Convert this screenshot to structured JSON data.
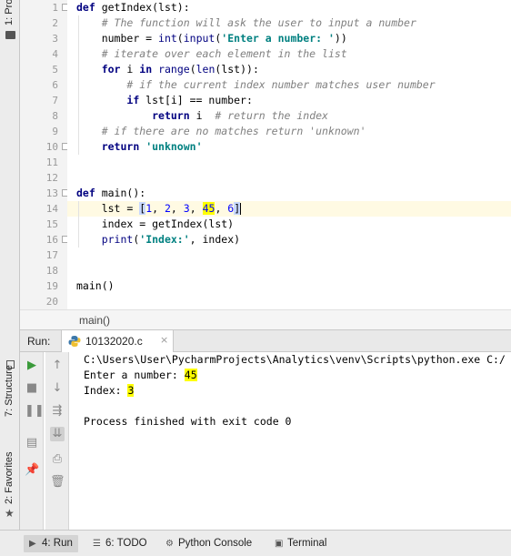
{
  "left_stripe": {
    "project_tab": "1: Pro",
    "structure_tab": "7: Structure",
    "favorites_tab": "2: Favorites"
  },
  "editor": {
    "line_numbers": [
      "1",
      "2",
      "3",
      "4",
      "5",
      "6",
      "7",
      "8",
      "9",
      "10",
      "11",
      "12",
      "13",
      "14",
      "15",
      "16",
      "17",
      "18",
      "19",
      "20"
    ],
    "caret_line": 14,
    "code": {
      "l1": {
        "kw": "def",
        "rest": " getIndex(lst):"
      },
      "l2": {
        "comment": "# The function will ask the user to input a number"
      },
      "l3": {
        "a": "number = ",
        "builtin1": "int",
        "b": "(",
        "builtin2": "input",
        "c": "(",
        "str": "'Enter a number: '",
        "d": "))"
      },
      "l4": {
        "comment": "# iterate over each element in the list"
      },
      "l5": {
        "kw1": "for",
        "a": " i ",
        "kw2": "in",
        "b": " ",
        "builtin1": "range",
        "c": "(",
        "builtin2": "len",
        "d": "(lst)):"
      },
      "l6": {
        "comment": "# if the current index number matches user number"
      },
      "l7": {
        "kw": "if",
        "rest": " lst[i] == number:"
      },
      "l8": {
        "kw": "return",
        "rest": " i  ",
        "comment": "# return the index"
      },
      "l9": {
        "comment": "# if there are no matches return 'unknown'"
      },
      "l10": {
        "kw": "return",
        "rest": " ",
        "str": "'unknown'"
      },
      "l13": {
        "kw": "def",
        "rest": " main():"
      },
      "l14": {
        "a": "lst = ",
        "bracket_open": "[",
        "n1": "1",
        "s1": ", ",
        "n2": "2",
        "s2": ", ",
        "n3": "3",
        "s3": ", ",
        "n4": "45",
        "s4": ", ",
        "n5": "6",
        "bracket_close": "]"
      },
      "l15": {
        "text": "index = getIndex(lst)"
      },
      "l16": {
        "builtin": "print",
        "a": "(",
        "str": "'Index:'",
        "b": ", index)"
      },
      "l19": {
        "text": "main()"
      }
    }
  },
  "breadcrumb": "main()",
  "run_window": {
    "label": "Run:",
    "tab_name": "10132020.c",
    "tab_close": "×",
    "console": {
      "command": "C:\\Users\\User\\PycharmProjects\\Analytics\\venv\\Scripts\\python.exe C:/",
      "prompt": "Enter a number: ",
      "input_value": "45",
      "index_label": "Index: ",
      "index_value": "3",
      "exit_message": "Process finished with exit code 0"
    }
  },
  "bottom_bar": {
    "run": "4: Run",
    "todo": "6: TODO",
    "python_console": "Python Console",
    "terminal": "Terminal"
  },
  "colors": {
    "keyword": "#000080",
    "comment": "#808080",
    "string": "#008080",
    "number": "#0000ff",
    "highlight": "#ffff00",
    "run_green": "#3a9a3a"
  }
}
